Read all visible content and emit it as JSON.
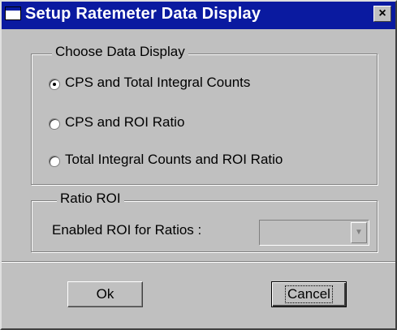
{
  "window": {
    "title": "Setup Ratemeter Data Display",
    "close_glyph": "×"
  },
  "choose_group": {
    "legend": "Choose Data Display",
    "options": [
      {
        "label": "CPS and Total Integral Counts",
        "selected": true
      },
      {
        "label": "CPS and ROI Ratio",
        "selected": false
      },
      {
        "label": "Total Integral Counts and ROI Ratio",
        "selected": false
      }
    ]
  },
  "ratio_group": {
    "legend": "Ratio ROI",
    "field_label": "Enabled ROI for Ratios :",
    "combo_value": "",
    "combo_enabled": false
  },
  "buttons": {
    "ok_label": "Ok",
    "cancel_label": "Cancel"
  },
  "icons": {
    "window_icon": "window-icon",
    "close": "close-icon",
    "combo_arrow": "chevron-down-icon"
  }
}
